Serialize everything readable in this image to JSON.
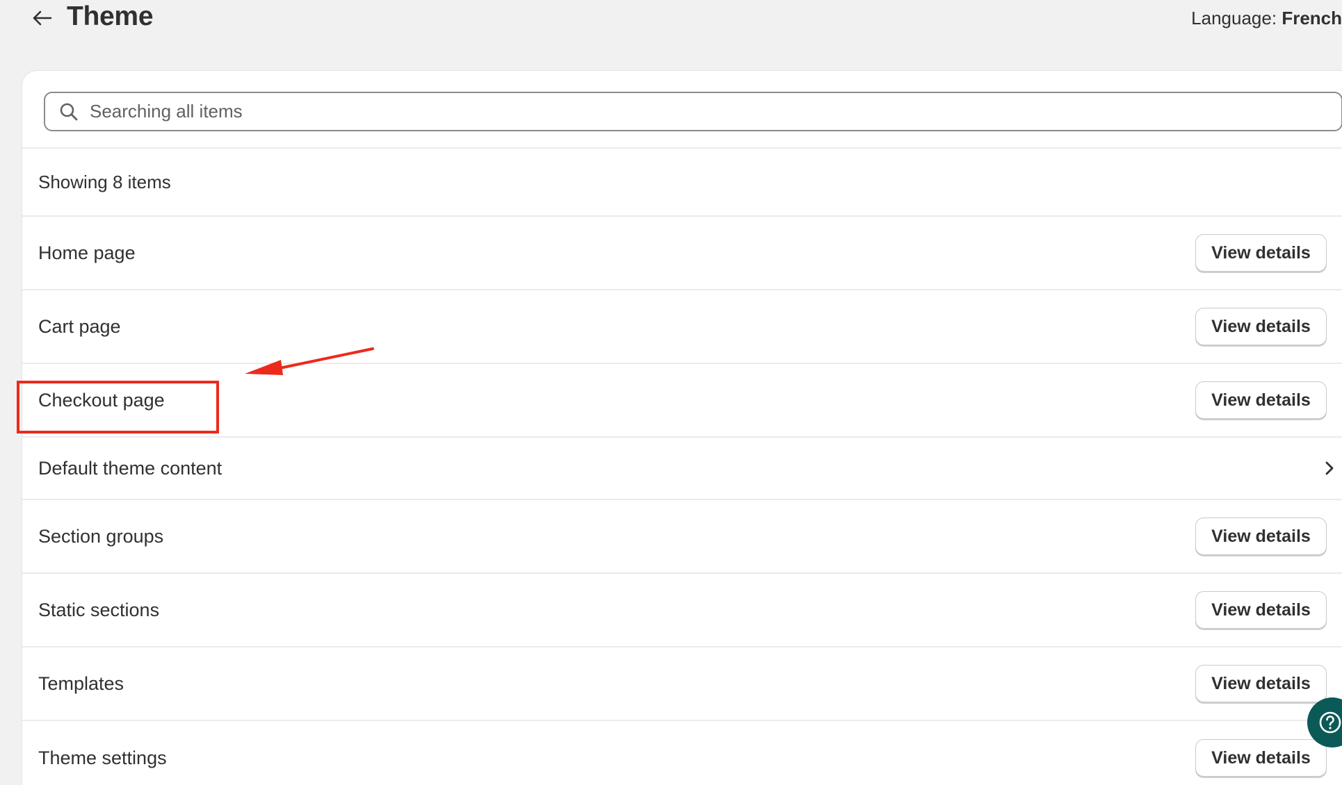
{
  "header": {
    "title": "Theme",
    "back_icon": "arrow-left-icon",
    "language_label": "Language:",
    "language_value": "French"
  },
  "search": {
    "placeholder": "Searching all items",
    "icon": "search-icon"
  },
  "list": {
    "summary": "Showing 8 items",
    "items": [
      {
        "label": "Home page",
        "action": "View details"
      },
      {
        "label": "Cart page",
        "action": "View details"
      },
      {
        "label": "Checkout page",
        "action": "View details"
      },
      {
        "label": "Default theme content",
        "action": "chevron-right-icon"
      },
      {
        "label": "Section groups",
        "action": "View details"
      },
      {
        "label": "Static sections",
        "action": "View details"
      },
      {
        "label": "Templates",
        "action": "View details"
      },
      {
        "label": "Theme settings",
        "action": "View details"
      }
    ]
  },
  "annotation": {
    "highlighted_item": "Checkout page",
    "color": "#ec2a1c"
  },
  "help": {
    "icon": "question-circle-icon",
    "color": "#0b5a57"
  }
}
